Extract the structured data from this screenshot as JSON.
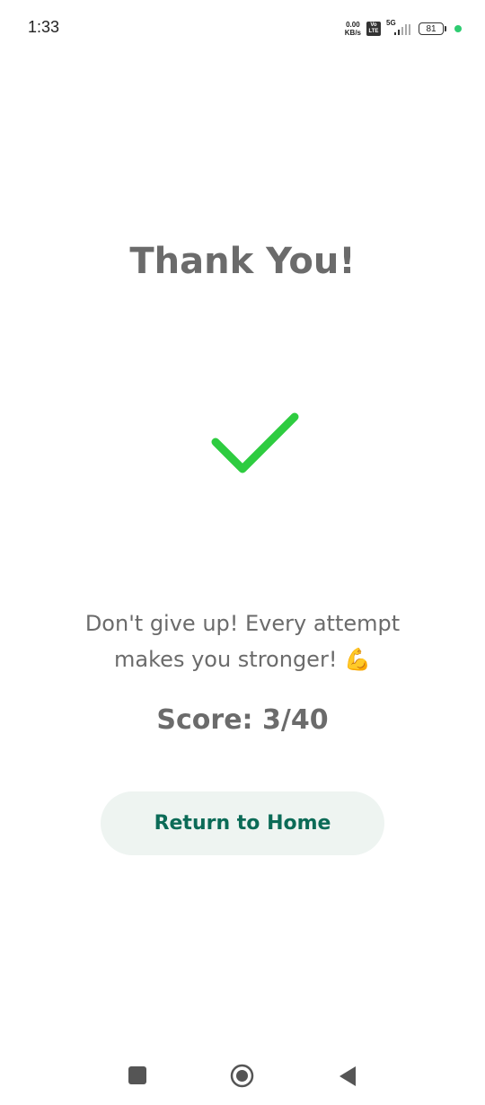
{
  "status_bar": {
    "time": "1:33",
    "net_speed_value": "0.00",
    "net_speed_unit": "KB/s",
    "volte_top": "Vo",
    "volte_bottom": "LTE",
    "network_type": "5G",
    "battery_level": "81",
    "indicator_color": "#2ecc71"
  },
  "main": {
    "title": "Thank You!",
    "check_icon": "check-icon",
    "check_color": "#2ecc40",
    "message_line1": "Don't give up! Every attempt",
    "message_line2": "makes you stronger! 💪",
    "score_text": "Score: 3/40",
    "home_button_label": "Return to Home",
    "accent_color": "#0b6b57"
  },
  "nav_bar": {
    "recent_icon": "recent-apps-icon",
    "home_icon": "home-icon",
    "back_icon": "back-icon"
  }
}
